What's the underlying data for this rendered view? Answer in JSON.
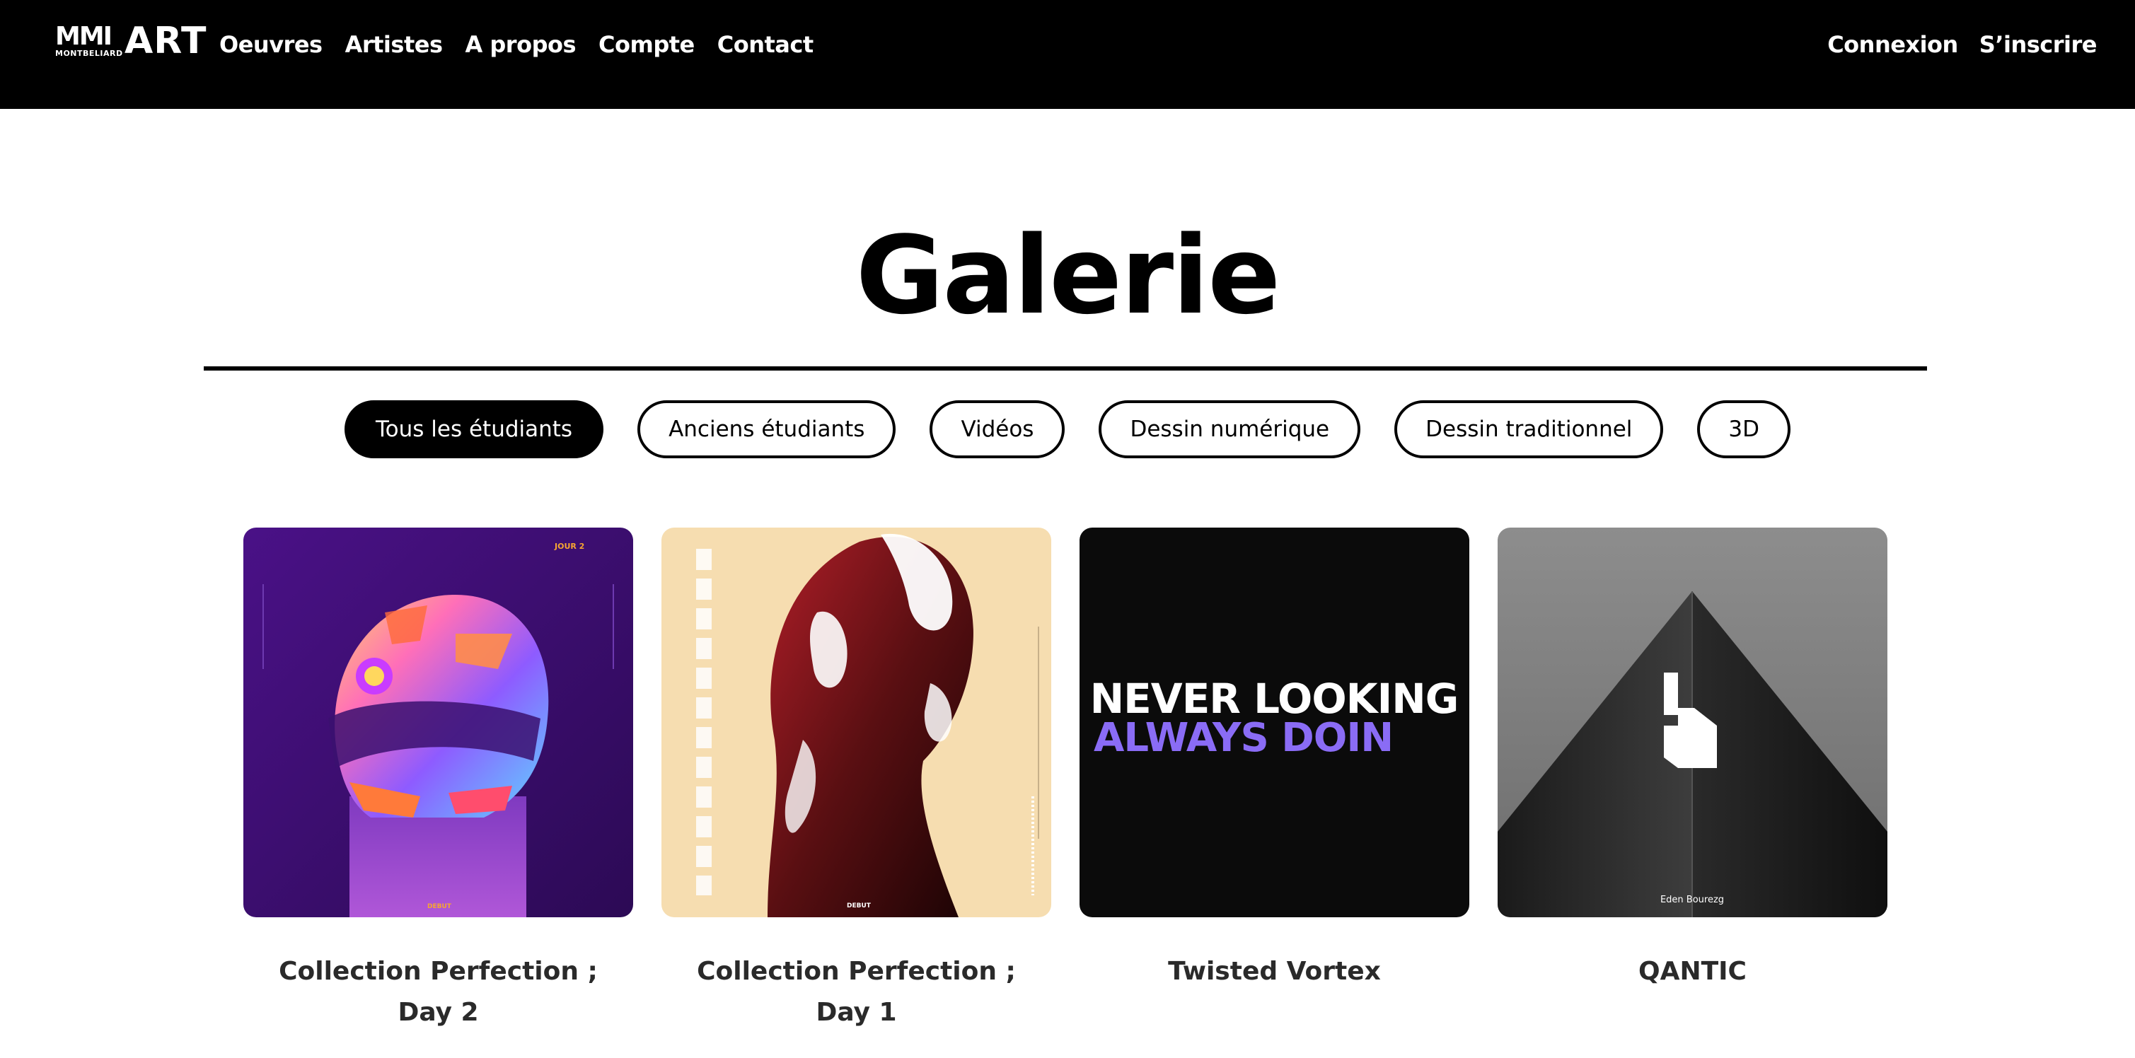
{
  "header": {
    "logo": {
      "mmi": "MMI",
      "sub": "MONTBELIARD",
      "art": "ART"
    },
    "nav_left": [
      "Oeuvres",
      "Artistes",
      "A propos",
      "Compte",
      "Contact"
    ],
    "nav_right": [
      "Connexion",
      "S’inscrire"
    ]
  },
  "page": {
    "title": "Galerie"
  },
  "filters": [
    {
      "label": "Tous les étudiants",
      "active": true
    },
    {
      "label": "Anciens étudiants",
      "active": false
    },
    {
      "label": "Vidéos",
      "active": false
    },
    {
      "label": "Dessin numérique",
      "active": false
    },
    {
      "label": "Dessin traditionnel",
      "active": false
    },
    {
      "label": "3D",
      "active": false
    }
  ],
  "artworks": [
    {
      "title": "Collection Perfection ; Day 2",
      "image_text": {
        "corner": "JOUR 2",
        "footer": "DEBUT"
      }
    },
    {
      "title": "Collection Perfection ; Day 1",
      "image_text": {
        "footer": "DEBUT"
      }
    },
    {
      "title": "Twisted Vortex",
      "image_text": {
        "line1": "NEVER LOOKING",
        "line2": "ALWAYS DOIN"
      }
    },
    {
      "title": "QANTIC",
      "image_text": {
        "footer": "Eden Bourezg"
      }
    }
  ],
  "colors": {
    "header_bg": "#000000",
    "accent_purple": "#8a6cf5",
    "card1_bg": "#3d0f6e",
    "card2_bg": "#f6ddb0"
  }
}
